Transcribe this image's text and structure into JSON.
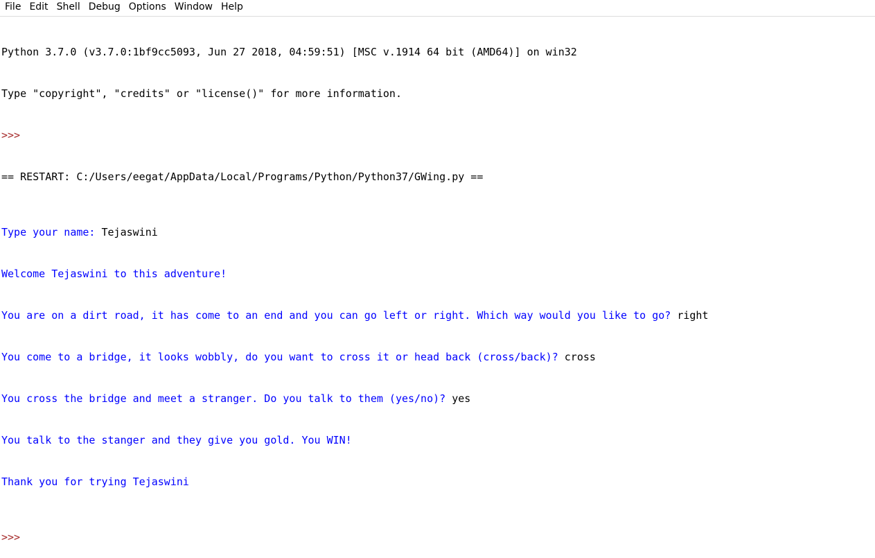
{
  "menubar": {
    "items": [
      "File",
      "Edit",
      "Shell",
      "Debug",
      "Options",
      "Window",
      "Help"
    ]
  },
  "shell": {
    "banner_line1": "Python 3.7.0 (v3.7.0:1bf9cc5093, Jun 27 2018, 04:59:51) [MSC v.1914 64 bit (AMD64)] on win32",
    "banner_line2": "Type \"copyright\", \"credits\" or \"license()\" for more information.",
    "prompt": ">>> ",
    "restart_line": "== RESTART: C:/Users/eegat/AppData/Local/Programs/Python/Python37/GWing.py ==",
    "lines": [
      {
        "out": "Type your name: ",
        "in": "Tejaswini"
      },
      {
        "out": "Welcome Tejaswini to this adventure!",
        "in": ""
      },
      {
        "out": "You are on a dirt road, it has come to an end and you can go left or right. Which way would you like to go? ",
        "in": "right"
      },
      {
        "out": "You come to a bridge, it looks wobbly, do you want to cross it or head back (cross/back)? ",
        "in": "cross"
      },
      {
        "out": "You cross the bridge and meet a stranger. Do you talk to them (yes/no)? ",
        "in": "yes"
      },
      {
        "out": "You talk to the stanger and they give you gold. You WIN!",
        "in": ""
      },
      {
        "out": "Thank you for trying Tejaswini",
        "in": ""
      }
    ],
    "final_prompt": ">>> "
  },
  "colors": {
    "prompt": "#a52a2a",
    "stdout": "#0000ff",
    "input": "#000000"
  }
}
